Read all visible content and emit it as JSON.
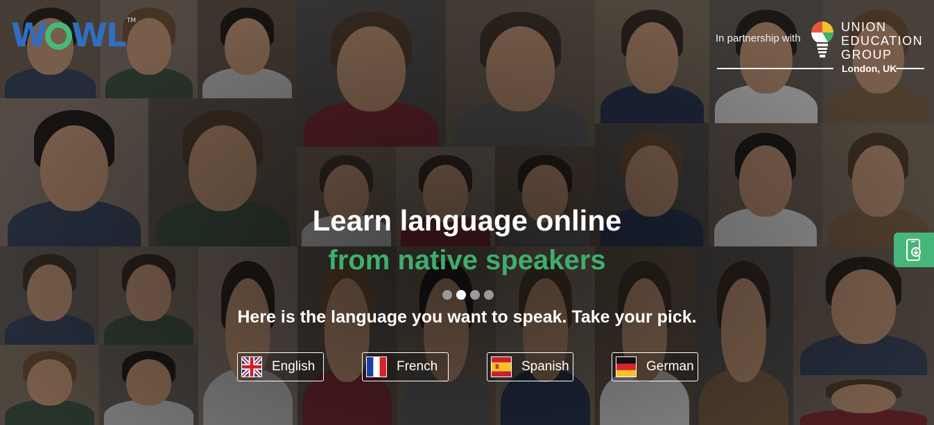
{
  "brand": {
    "logo_text": "WOWL",
    "logo_tm": "TM"
  },
  "partner": {
    "label": "In partnership with",
    "org_line1": "UNION",
    "org_line2": "EDUCATION",
    "org_line3": "GROUP",
    "location": "London, UK"
  },
  "hero": {
    "headline": "Learn language online",
    "subheadline": "from native speakers",
    "tagline": "Here is the language you want to speak. Take your pick.",
    "carousel_total": 4,
    "carousel_active": 2
  },
  "languages": [
    {
      "label": "English",
      "flag": "uk-flag-icon"
    },
    {
      "label": "French",
      "flag": "france-flag-icon"
    },
    {
      "label": "Spanish",
      "flag": "spain-flag-icon"
    },
    {
      "label": "German",
      "flag": "germany-flag-icon"
    }
  ],
  "side_tab": {
    "icon": "mobile-download-icon"
  },
  "colors": {
    "accent_green": "#3fae6e",
    "brand_blue": "#2f6fc2",
    "tab_green": "#47b67a"
  }
}
